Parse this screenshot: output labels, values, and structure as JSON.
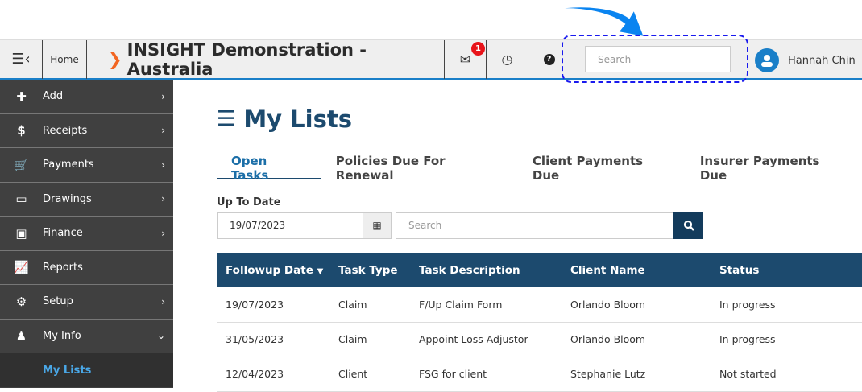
{
  "header": {
    "home": "Home",
    "title": "INSIGHT Demonstration - Australia",
    "mail_badge": "1",
    "search_placeholder": "Search",
    "user_name": "Hannah Chin"
  },
  "sidebar": {
    "items": [
      {
        "label": "Add"
      },
      {
        "label": "Receipts"
      },
      {
        "label": "Payments"
      },
      {
        "label": "Drawings"
      },
      {
        "label": "Finance"
      },
      {
        "label": "Reports"
      },
      {
        "label": "Setup"
      },
      {
        "label": "My Info"
      }
    ],
    "sub_item": "My Lists"
  },
  "main": {
    "title": "My Lists",
    "tabs": [
      "Open Tasks",
      "Policies Due For Renewal",
      "Client Payments Due",
      "Insurer Payments Due"
    ],
    "filter_label": "Up To Date",
    "date_value": "19/07/2023",
    "search_placeholder": "Search",
    "columns": [
      "Followup Date",
      "Task Type",
      "Task Description",
      "Client Name",
      "Status"
    ],
    "rows": [
      [
        "19/07/2023",
        "Claim",
        "F/Up Claim Form",
        "Orlando Bloom",
        "In progress"
      ],
      [
        "31/05/2023",
        "Claim",
        "Appoint Loss Adjustor",
        "Orlando Bloom",
        "In progress"
      ],
      [
        "12/04/2023",
        "Client",
        "FSG for client",
        "Stephanie Lutz",
        "Not started"
      ]
    ]
  }
}
